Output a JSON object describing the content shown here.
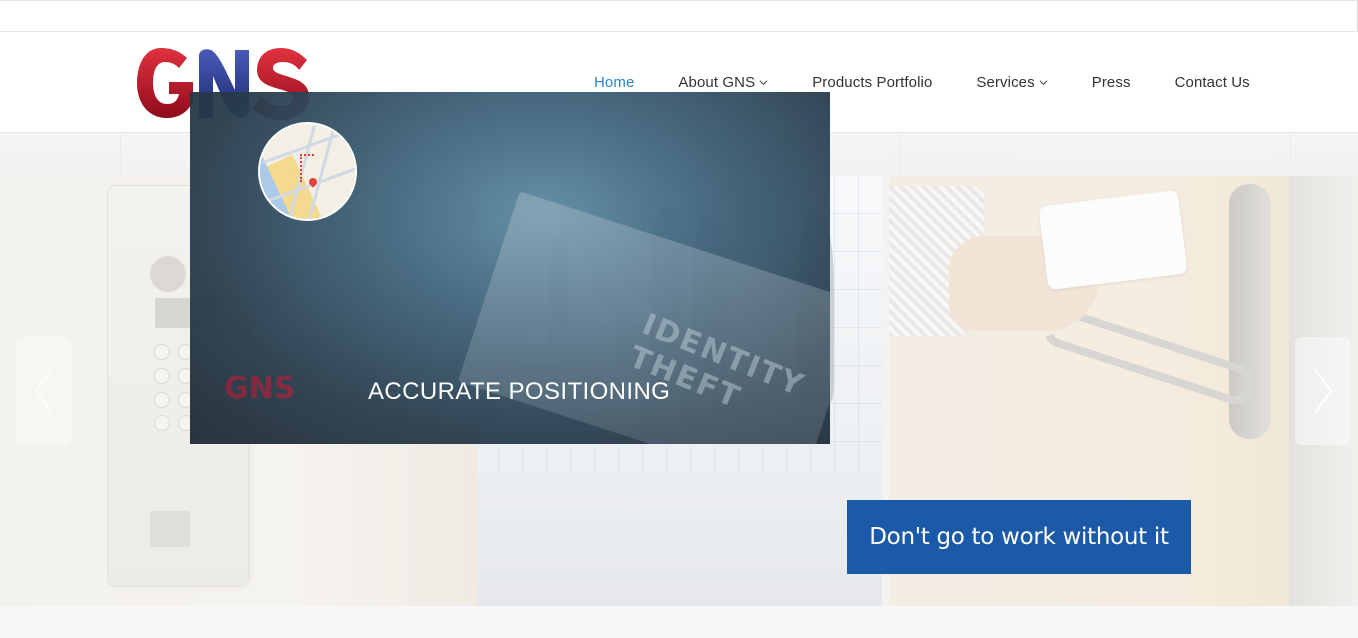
{
  "brand": {
    "logo_text": "GNS",
    "logo_colors": {
      "red": "#c8102e",
      "blue": "#2b3a8f"
    }
  },
  "nav": {
    "items": [
      {
        "label": "Home",
        "active": true,
        "has_dropdown": false
      },
      {
        "label": "About GNS",
        "active": false,
        "has_dropdown": true
      },
      {
        "label": "Products Portfolio",
        "active": false,
        "has_dropdown": false
      },
      {
        "label": "Services",
        "active": false,
        "has_dropdown": true
      },
      {
        "label": "Press",
        "active": false,
        "has_dropdown": false
      },
      {
        "label": "Contact Us",
        "active": false,
        "has_dropdown": false
      }
    ],
    "active_color": "#2a84c8",
    "text_color": "#333333"
  },
  "slider": {
    "slide_caption": "ACCURATE POSITIONING",
    "banner_text": "Don't go to work without it",
    "banner_color": "#1a5aa8",
    "watermark_text": "IDENTITY THEFT",
    "mini_logo_text": "GNS",
    "prev_icon": "chevron-left-icon",
    "next_icon": "chevron-right-icon"
  }
}
